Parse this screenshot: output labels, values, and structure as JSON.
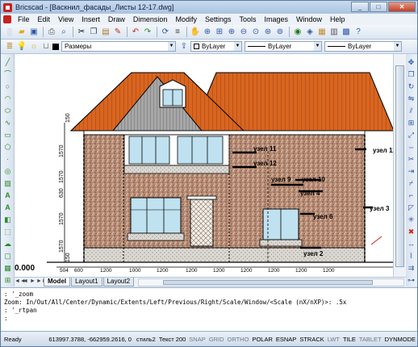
{
  "window": {
    "title": "Bricscad - [Васкнил_фасады_Листы 12-17.dwg]",
    "controls": [
      "_",
      "□",
      "✕"
    ]
  },
  "menu": [
    "File",
    "Edit",
    "View",
    "Insert",
    "Draw",
    "Dimension",
    "Modify",
    "Settings",
    "Tools",
    "Images",
    "Window",
    "Help"
  ],
  "props": {
    "layer": "Размеры",
    "color": "ByLayer",
    "linetype": "ByLayer",
    "lineweight": "ByLayer"
  },
  "tabs": [
    "Model",
    "Layout1",
    "Layout2"
  ],
  "command_history": [
    ": '_zoom",
    "Zoom:  In/Out/All/Center/Dynamic/Extents/Left/Previous/Right/Scale/Window/<Scale (nX/nXP)>: .5x",
    ": '_rtpan",
    ":"
  ],
  "status": {
    "ready": "Ready",
    "coordinates": "613997.3788, -662959.2616, 0",
    "text_style": "стиль2",
    "text_height": "Текст 200",
    "toggles": [
      {
        "label": "SNAP",
        "on": false
      },
      {
        "label": "GRID",
        "on": false
      },
      {
        "label": "ORTHO",
        "on": false
      },
      {
        "label": "POLAR",
        "on": true
      },
      {
        "label": "ESNAP",
        "on": true
      },
      {
        "label": "STRACK",
        "on": true
      },
      {
        "label": "LWT",
        "on": false
      },
      {
        "label": "TILE",
        "on": true
      },
      {
        "label": "TABLET",
        "on": false
      },
      {
        "label": "DYNMODE",
        "on": true
      }
    ]
  },
  "drawing": {
    "callouts": [
      "узел 11",
      "узел 12",
      "узел 9",
      "узел 10",
      "узел 4",
      "узел 6",
      "узел 2",
      "узел 11",
      "узел 3"
    ],
    "vertical_dims": [
      "150",
      "1570",
      "1570",
      "630",
      "1570",
      "1570",
      "150"
    ],
    "horizontal_dims": [
      "504",
      "600",
      "1200",
      "1000",
      "1200",
      "1200",
      "1200",
      "1200",
      "1200",
      "1200",
      "1200"
    ],
    "level_mark": "0.000",
    "colors": {
      "roof": "#d9651f",
      "gable": "#9a9a9a",
      "wall": "#b78a72",
      "plinth": "#c9c5c0"
    }
  }
}
